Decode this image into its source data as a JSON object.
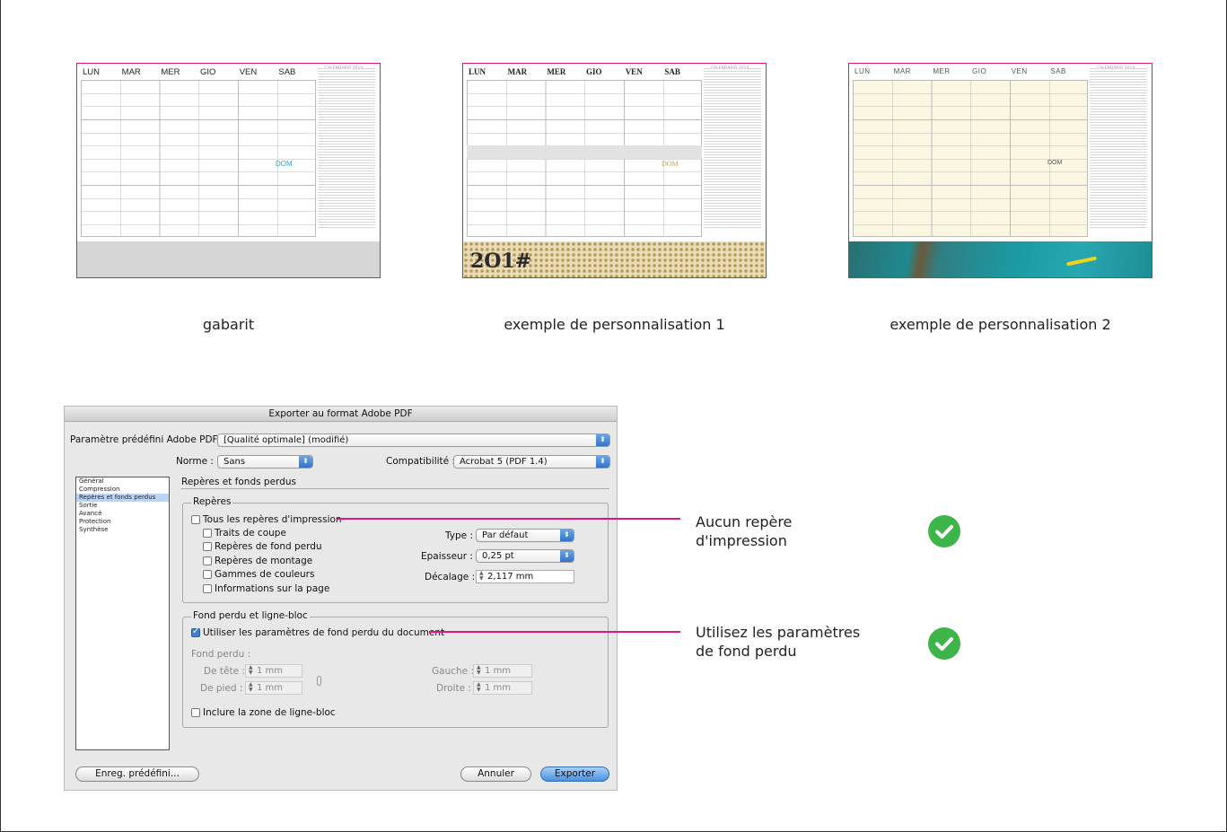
{
  "calendar": {
    "days": [
      "LUN",
      "MAR",
      "MER",
      "GIO",
      "VEN",
      "SAB"
    ],
    "dom_label": "DOM",
    "mini_title": "CALENDARIO 2014",
    "preview_2_band_text": "2O1#"
  },
  "captions": {
    "template": "gabarit",
    "example_1": "exemple de personnalisation 1",
    "example_2": "exemple de personnalisation 2"
  },
  "dialog": {
    "title": "Exporter au format Adobe PDF",
    "preset_label": "Paramètre prédéfini Adobe PDF :",
    "preset_value": "[Qualité optimale] (modifié)",
    "norme_label": "Norme :",
    "norme_value": "Sans",
    "compat_label": "Compatibilité :",
    "compat_value": "Acrobat 5 (PDF 1.4)",
    "sidebar_items": [
      "Général",
      "Compression",
      "Repères et fonds perdus",
      "Sortie",
      "Avancé",
      "Protection",
      "Synthèse"
    ],
    "section_title": "Repères et fonds perdus",
    "marks_group": {
      "title": "Repères",
      "all_marks": "Tous les repères d'impression",
      "crop": "Traits de coupe",
      "bleed": "Repères de fond perdu",
      "registration": "Repères de montage",
      "color_bars": "Gammes de couleurs",
      "page_info": "Informations sur la page",
      "type_label": "Type :",
      "type_value": "Par défaut",
      "weight_label": "Epaisseur :",
      "weight_value": "0,25 pt",
      "offset_label": "Décalage :",
      "offset_value": "2,117 mm"
    },
    "bleed_group": {
      "title": "Fond perdu et ligne-bloc",
      "use_doc_bleed": "Utiliser les paramètres de fond perdu du document",
      "use_doc_bleed_checked": true,
      "bleed_label": "Fond perdu :",
      "top_label": "De tête :",
      "top_value": "1 mm",
      "bottom_label": "De pied :",
      "bottom_value": "1 mm",
      "left_label": "Gauche :",
      "left_value": "1 mm",
      "right_label": "Droite :",
      "right_value": "1 mm",
      "slug": "Inclure la zone de ligne-bloc"
    },
    "buttons": {
      "save_preset": "Enreg. prédéfini...",
      "cancel": "Annuler",
      "export": "Exporter"
    }
  },
  "annotations": {
    "note_1_line_1": "Aucun repère",
    "note_1_line_2": "d'impression",
    "note_2_line_1": "Utilisez les paramètres",
    "note_2_line_2": "de fond perdu"
  },
  "colors": {
    "accent_pink": "#e0177e",
    "check_green": "#3eb549",
    "dom_blue": "#2aa0d8",
    "dom_gold": "#c9a24a"
  }
}
